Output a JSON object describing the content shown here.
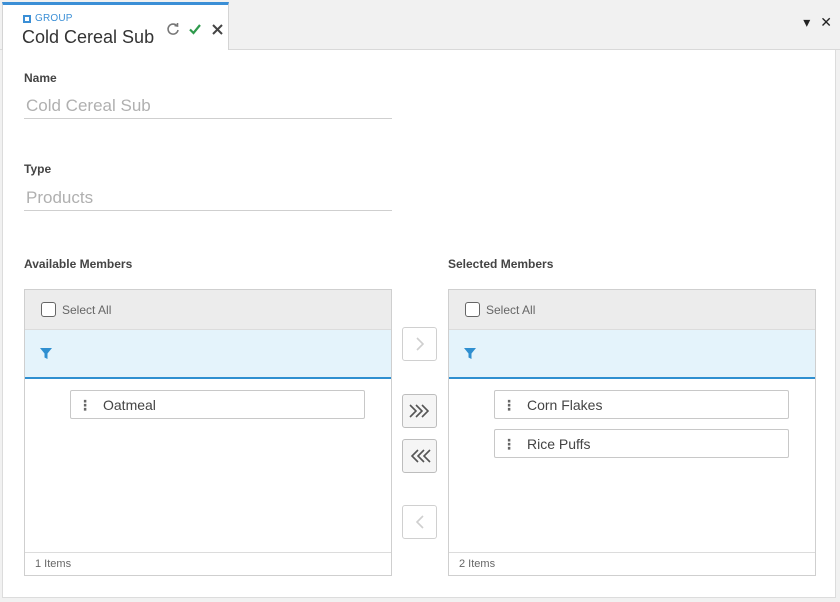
{
  "tab": {
    "type_label": "GROUP",
    "title": "Cold Cereal Sub"
  },
  "window_controls": {
    "menu_glyph": "▾",
    "close_glyph": "✕"
  },
  "form": {
    "name_label": "Name",
    "name_value": "Cold Cereal Sub",
    "type_label": "Type",
    "type_value": "Products"
  },
  "available": {
    "title": "Available Members",
    "select_all_label": "Select All",
    "items": [
      "Oatmeal"
    ],
    "footer": "1 Items"
  },
  "selected": {
    "title": "Selected Members",
    "select_all_label": "Select All",
    "items": [
      "Corn Flakes",
      "Rice Puffs"
    ],
    "footer": "2 Items"
  },
  "colors": {
    "accent": "#3b8fd6",
    "filter_row": "#e4f3fb",
    "check": "#2e9a4c"
  }
}
